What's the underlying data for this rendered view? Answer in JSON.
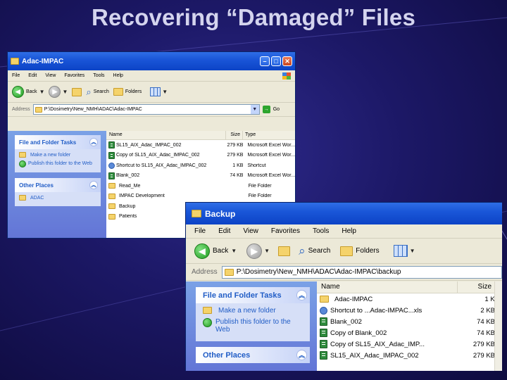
{
  "slide": {
    "title": "Recovering “Damaged” Files"
  },
  "win1": {
    "title": "Adac-IMPAC",
    "menu": [
      "File",
      "Edit",
      "View",
      "Favorites",
      "Tools",
      "Help"
    ],
    "toolbar": {
      "back": "Back",
      "search": "Search",
      "folders": "Folders"
    },
    "address_label": "Address",
    "address": "P:\\Dosimetry\\New_NMH\\ADAC\\Adac-IMPAC",
    "go": "Go",
    "tasks": {
      "title": "File and Folder Tasks",
      "items": [
        "Make a new folder",
        "Publish this folder to the Web"
      ]
    },
    "other_places": {
      "title": "Other Places",
      "items": [
        "ADAC"
      ]
    },
    "columns": {
      "name": "Name",
      "size": "Size",
      "type": "Type"
    },
    "files": [
      {
        "icon": "excel-file-icon",
        "name": "SL15_AIX_Adac_IMPAC_002",
        "size": "279 KB",
        "type": "Microsoft Excel Wor..."
      },
      {
        "icon": "excel-file-icon",
        "name": "Copy of SL15_AIX_Adac_IMPAC_002",
        "size": "279 KB",
        "type": "Microsoft Excel Wor..."
      },
      {
        "icon": "shortcut-icon",
        "name": "Shortcut to SL15_AIX_Adac_IMPAC_002",
        "size": "1 KB",
        "type": "Shortcut"
      },
      {
        "icon": "excel-file-icon",
        "name": "Blank_002",
        "size": "74 KB",
        "type": "Microsoft Excel Wor..."
      },
      {
        "icon": "folder-icon",
        "name": "Read_Me",
        "size": "",
        "type": "File Folder"
      },
      {
        "icon": "folder-icon",
        "name": "IMPAC Development",
        "size": "",
        "type": "File Folder"
      },
      {
        "icon": "folder-icon",
        "name": "Backup",
        "size": "",
        "type": "File Folder"
      },
      {
        "icon": "folder-icon",
        "name": "Patients",
        "size": "",
        "type": ""
      }
    ]
  },
  "win2": {
    "title": "Backup",
    "menu": [
      "File",
      "Edit",
      "View",
      "Favorites",
      "Tools",
      "Help"
    ],
    "toolbar": {
      "back": "Back",
      "search": "Search",
      "folders": "Folders"
    },
    "address_label": "Address",
    "address": "P:\\Dosimetry\\New_NMH\\ADAC\\Adac-IMPAC\\backup",
    "tasks": {
      "title": "File and Folder Tasks",
      "items": [
        "Make a new folder",
        "Publish this folder to the Web"
      ]
    },
    "other_places": {
      "title": "Other Places"
    },
    "columns": {
      "name": "Name",
      "size": "Size"
    },
    "files": [
      {
        "icon": "folder-icon",
        "name": "Adac-IMPAC",
        "size": "1 KB"
      },
      {
        "icon": "shortcut-icon",
        "name": "Shortcut to ...Adac-IMPAC...xls",
        "size": "2 KB"
      },
      {
        "icon": "excel-file-icon",
        "name": "Blank_002",
        "size": "74 KB"
      },
      {
        "icon": "excel-file-icon",
        "name": "Copy of Blank_002",
        "size": "74 KB"
      },
      {
        "icon": "excel-file-icon",
        "name": "Copy of SL15_AIX_Adac_IMP...",
        "size": "279 KB"
      },
      {
        "icon": "excel-file-icon",
        "name": "SL15_AIX_Adac_IMPAC_002",
        "size": "279 KB"
      }
    ]
  },
  "colors": {
    "slide_bg": "#1c1866",
    "title_text": "#d4d4ee",
    "titlebar_blue": "#0c43c6",
    "task_link": "#215dc6"
  }
}
